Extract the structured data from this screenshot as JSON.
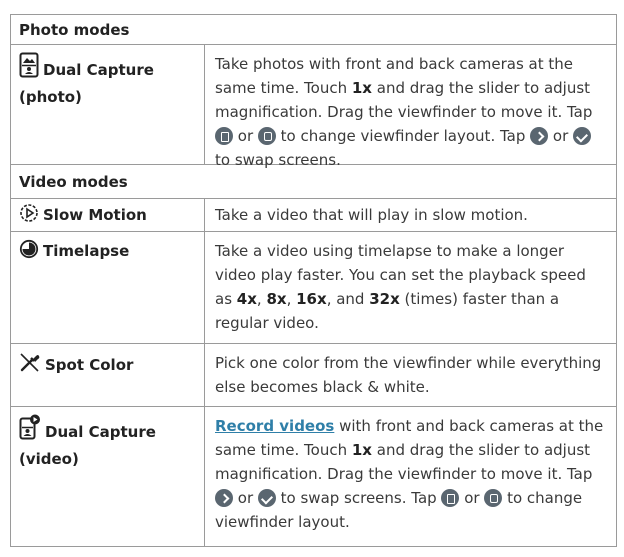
{
  "sections": {
    "photo": "Photo modes",
    "video": "Video modes"
  },
  "rows": {
    "dual_photo": {
      "title_line1": "Dual Capture",
      "title_line2": "(photo)",
      "t1": "Take photos with front and back cameras at the same time. Touch ",
      "b1": "1x",
      "t2": " and drag the slider to adjust magnification. Drag the viewfinder to move it. Tap ",
      "t3": " or ",
      "t4": " to change viewfinder layout. Tap ",
      "t5": " or ",
      "t6": " to swap screens."
    },
    "slow_motion": {
      "title": "Slow Motion",
      "text": "Take a video that will play in slow motion."
    },
    "timelapse": {
      "title": "Timelapse",
      "t1": "Take a video using timelapse to make a longer video play faster. You can set the playback speed as ",
      "b1": "4x",
      "s1": ", ",
      "b2": "8x",
      "s2": ", ",
      "b3": "16x",
      "s3": ", and ",
      "b4": "32x",
      "t2": " (times) faster than a regular video."
    },
    "spot_color": {
      "title": "Spot Color",
      "text": "Pick one color from the viewfinder while everything else becomes black & white."
    },
    "dual_video": {
      "title_line1": "Dual Capture",
      "title_line2": "(video)",
      "link": "Record videos",
      "t1": " with front and back cameras at the same time. Touch ",
      "b1": "1x",
      "t2": " and drag the slider to adjust magnification. Drag the viewfinder to move it. Tap ",
      "t3": " or ",
      "t4": " to swap screens. Tap ",
      "t5": " or ",
      "t6": " to change viewfinder layout."
    }
  },
  "icons": {
    "dual_photo": "dual-capture-photo-icon",
    "slow_motion": "slow-motion-icon",
    "timelapse": "timelapse-icon",
    "spot_color": "spot-color-icon",
    "dual_video": "dual-capture-video-icon"
  }
}
